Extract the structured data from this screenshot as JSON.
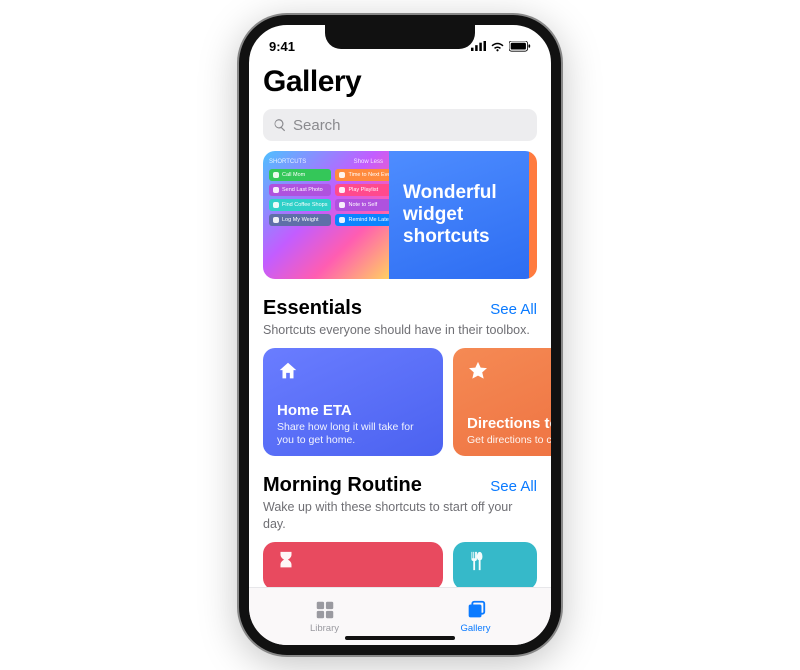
{
  "status": {
    "time": "9:41"
  },
  "page": {
    "title": "Gallery"
  },
  "search": {
    "placeholder": "Search"
  },
  "hero": {
    "title": "Wonderful widget shortcuts",
    "left_header": "SHORTCUTS",
    "left_header_right": "Show Less",
    "chips_left": [
      "Call Mom",
      "Send Last Photo",
      "Find Coffee Shops",
      "Log My Weight"
    ],
    "chips_right": [
      "Time to Next Event",
      "Play Playlist",
      "Note to Self",
      "Remind Me Later"
    ]
  },
  "sections": [
    {
      "title": "Essentials",
      "see_all": "See All",
      "subtitle": "Shortcuts everyone should have in their toolbox.",
      "cards": [
        {
          "name": "Home ETA",
          "desc": "Share how long it will take for you to get home.",
          "icon": "home"
        },
        {
          "name": "Directions to Event",
          "desc": "Get directions to calendar event.",
          "icon": "star"
        }
      ]
    },
    {
      "title": "Morning Routine",
      "see_all": "See All",
      "subtitle": "Wake up with these shortcuts to start off your day."
    }
  ],
  "tabs": {
    "library": "Library",
    "gallery": "Gallery"
  }
}
